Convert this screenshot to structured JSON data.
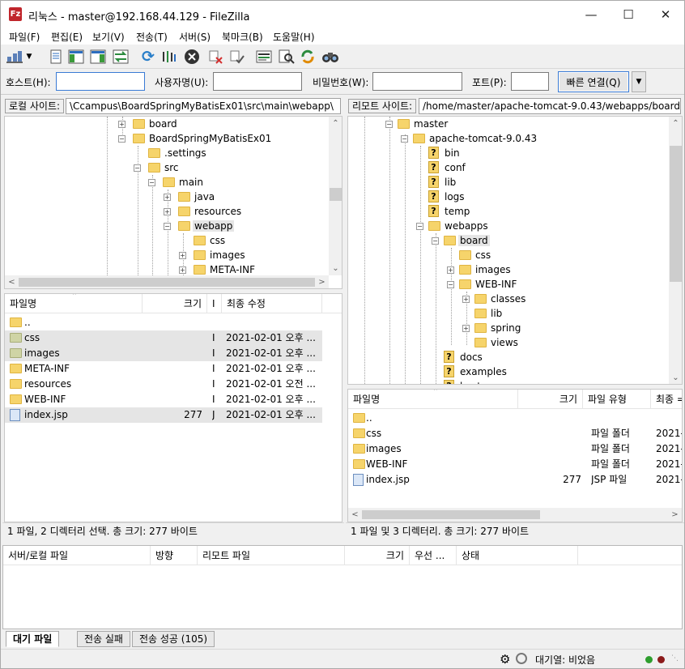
{
  "window": {
    "title": "리눅스 - master@192.168.44.129 - FileZilla",
    "logo_text": "Fz"
  },
  "menu": [
    "파일(F)",
    "편집(E)",
    "보기(V)",
    "전송(T)",
    "서버(S)",
    "북마크(B)",
    "도움말(H)"
  ],
  "toolbar_icons": [
    "site-manager-icon",
    "dropdown-arrow-icon",
    "message-log-icon",
    "local-tree-icon",
    "remote-tree-icon",
    "transfer-queue-icon",
    "refresh-icon",
    "process-queue-icon",
    "cancel-icon",
    "disconnect-icon",
    "reconnect-icon",
    "directory-filter-icon",
    "compare-icon",
    "sync-browse-icon",
    "search-icon"
  ],
  "quickconnect": {
    "host_label": "호스트(H):",
    "host_value": "",
    "user_label": "사용자명(U):",
    "user_value": "",
    "pass_label": "비밀번호(W):",
    "pass_value": "",
    "port_label": "포트(P):",
    "port_value": "",
    "button": "빠른 연결(Q)"
  },
  "local": {
    "site_label": "로컬 사이트:",
    "path": "\\Ccampus\\BoardSpringMyBatisEx01\\src\\main\\webapp\\",
    "tree": [
      "board",
      "BoardSpringMyBatisEx01",
      ".settings",
      "src",
      "main",
      "java",
      "resources",
      "webapp",
      "css",
      "images",
      "META-INF"
    ],
    "columns": [
      "파일명",
      "크기",
      "I",
      "최종 수정"
    ],
    "files": [
      {
        "name": "..",
        "size": "",
        "type": "",
        "modified": ""
      },
      {
        "name": "css",
        "size": "",
        "type": "I",
        "modified": "2021-02-01 오후 ..."
      },
      {
        "name": "images",
        "size": "",
        "type": "I",
        "modified": "2021-02-01 오후 ..."
      },
      {
        "name": "META-INF",
        "size": "",
        "type": "I",
        "modified": "2021-02-01 오후 ..."
      },
      {
        "name": "resources",
        "size": "",
        "type": "I",
        "modified": "2021-02-01 오전 ..."
      },
      {
        "name": "WEB-INF",
        "size": "",
        "type": "I",
        "modified": "2021-02-01 오후 ..."
      },
      {
        "name": "index.jsp",
        "size": "277",
        "type": "J",
        "modified": "2021-02-01 오후 ..."
      }
    ],
    "status": "1 파일, 2 디렉터리 선택. 총 크기: 277 바이트"
  },
  "remote": {
    "site_label": "리모트 사이트:",
    "path": "/home/master/apache-tomcat-9.0.43/webapps/board",
    "tree": [
      "master",
      "apache-tomcat-9.0.43",
      "bin",
      "conf",
      "lib",
      "logs",
      "temp",
      "webapps",
      "board",
      "css",
      "images",
      "WEB-INF",
      "classes",
      "lib",
      "spring",
      "views",
      "docs",
      "examples",
      "host-manager"
    ],
    "columns": [
      "파일명",
      "크기",
      "파일 유형",
      "최종 ="
    ],
    "files": [
      {
        "name": "..",
        "size": "",
        "type": "",
        "modified": ""
      },
      {
        "name": "css",
        "size": "",
        "type": "파일 폴더",
        "modified": "2021-"
      },
      {
        "name": "images",
        "size": "",
        "type": "파일 폴더",
        "modified": "2021-"
      },
      {
        "name": "WEB-INF",
        "size": "",
        "type": "파일 폴더",
        "modified": "2021-"
      },
      {
        "name": "index.jsp",
        "size": "277",
        "type": "JSP 파일",
        "modified": "2021-"
      }
    ],
    "status": "1 파일 및 3 디렉터리. 총 크기: 277 바이트"
  },
  "queue": {
    "columns": [
      "서버/로컬 파일",
      "방향",
      "리모트 파일",
      "크기",
      "우선 ...",
      "상태"
    ],
    "tabs": [
      "대기 파일",
      "전송 실패",
      "전송 성공 (105)"
    ]
  },
  "statusbar": {
    "queue_text": "대기열: 비었음"
  },
  "colors": {
    "folder": "#f6d46b",
    "selected": "#e5e5e5",
    "accent": "#3a7bd5"
  }
}
